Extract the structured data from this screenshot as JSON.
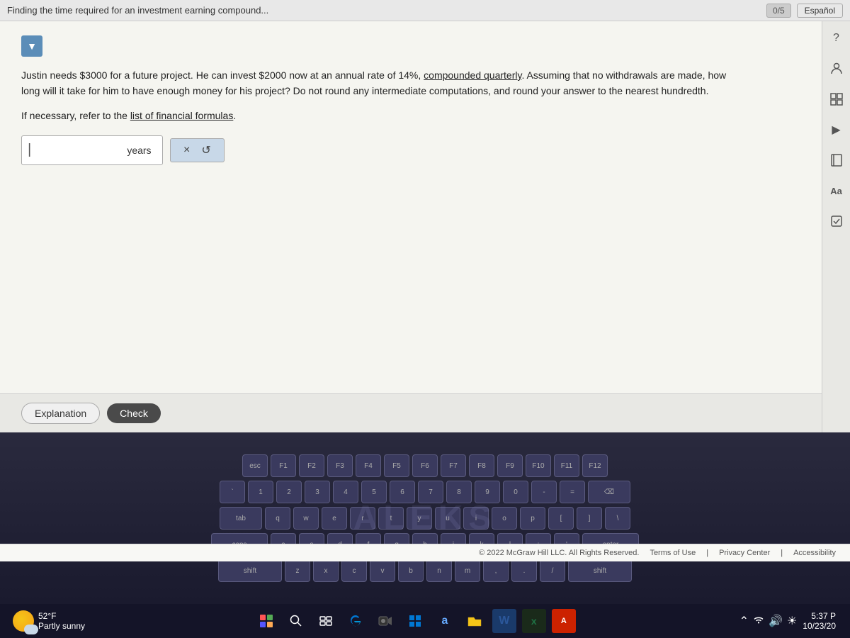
{
  "header": {
    "title": "Finding the time required for an investment earning compound...",
    "score": "0/5",
    "espa_label": "Español"
  },
  "problem": {
    "text1": "Justin needs $3000 for a future project. He can invest $2000 now at an annual rate of 14%, compounded quarterly. Assuming that no withdrawals are made, how long will it take for him to have enough money for his project? Do not round any intermediate computations, and round your answer to the nearest hundredth.",
    "text2": "If necessary, refer to the list of financial formulas.",
    "link_text": "list of financial formulas",
    "compound_link": "compounded quarterly"
  },
  "answer": {
    "placeholder": "",
    "years_label": "years",
    "input_value": ""
  },
  "buttons": {
    "x_label": "×",
    "refresh_label": "↺",
    "explanation_label": "Explanation",
    "check_label": "Check"
  },
  "footer": {
    "copyright": "© 2022 McGraw Hill LLC. All Rights Reserved.",
    "terms": "Terms of Use",
    "privacy": "Privacy Center",
    "accessibility": "Accessibility"
  },
  "taskbar": {
    "weather_temp": "52°F",
    "weather_condition": "Partly sunny",
    "time": "5:37 P",
    "date": "10/23/20"
  },
  "sidebar_icons": {
    "question": "?",
    "person": "👤",
    "grid": "▦",
    "play": "▶",
    "book": "📖",
    "text": "Aa",
    "check": "✓"
  }
}
